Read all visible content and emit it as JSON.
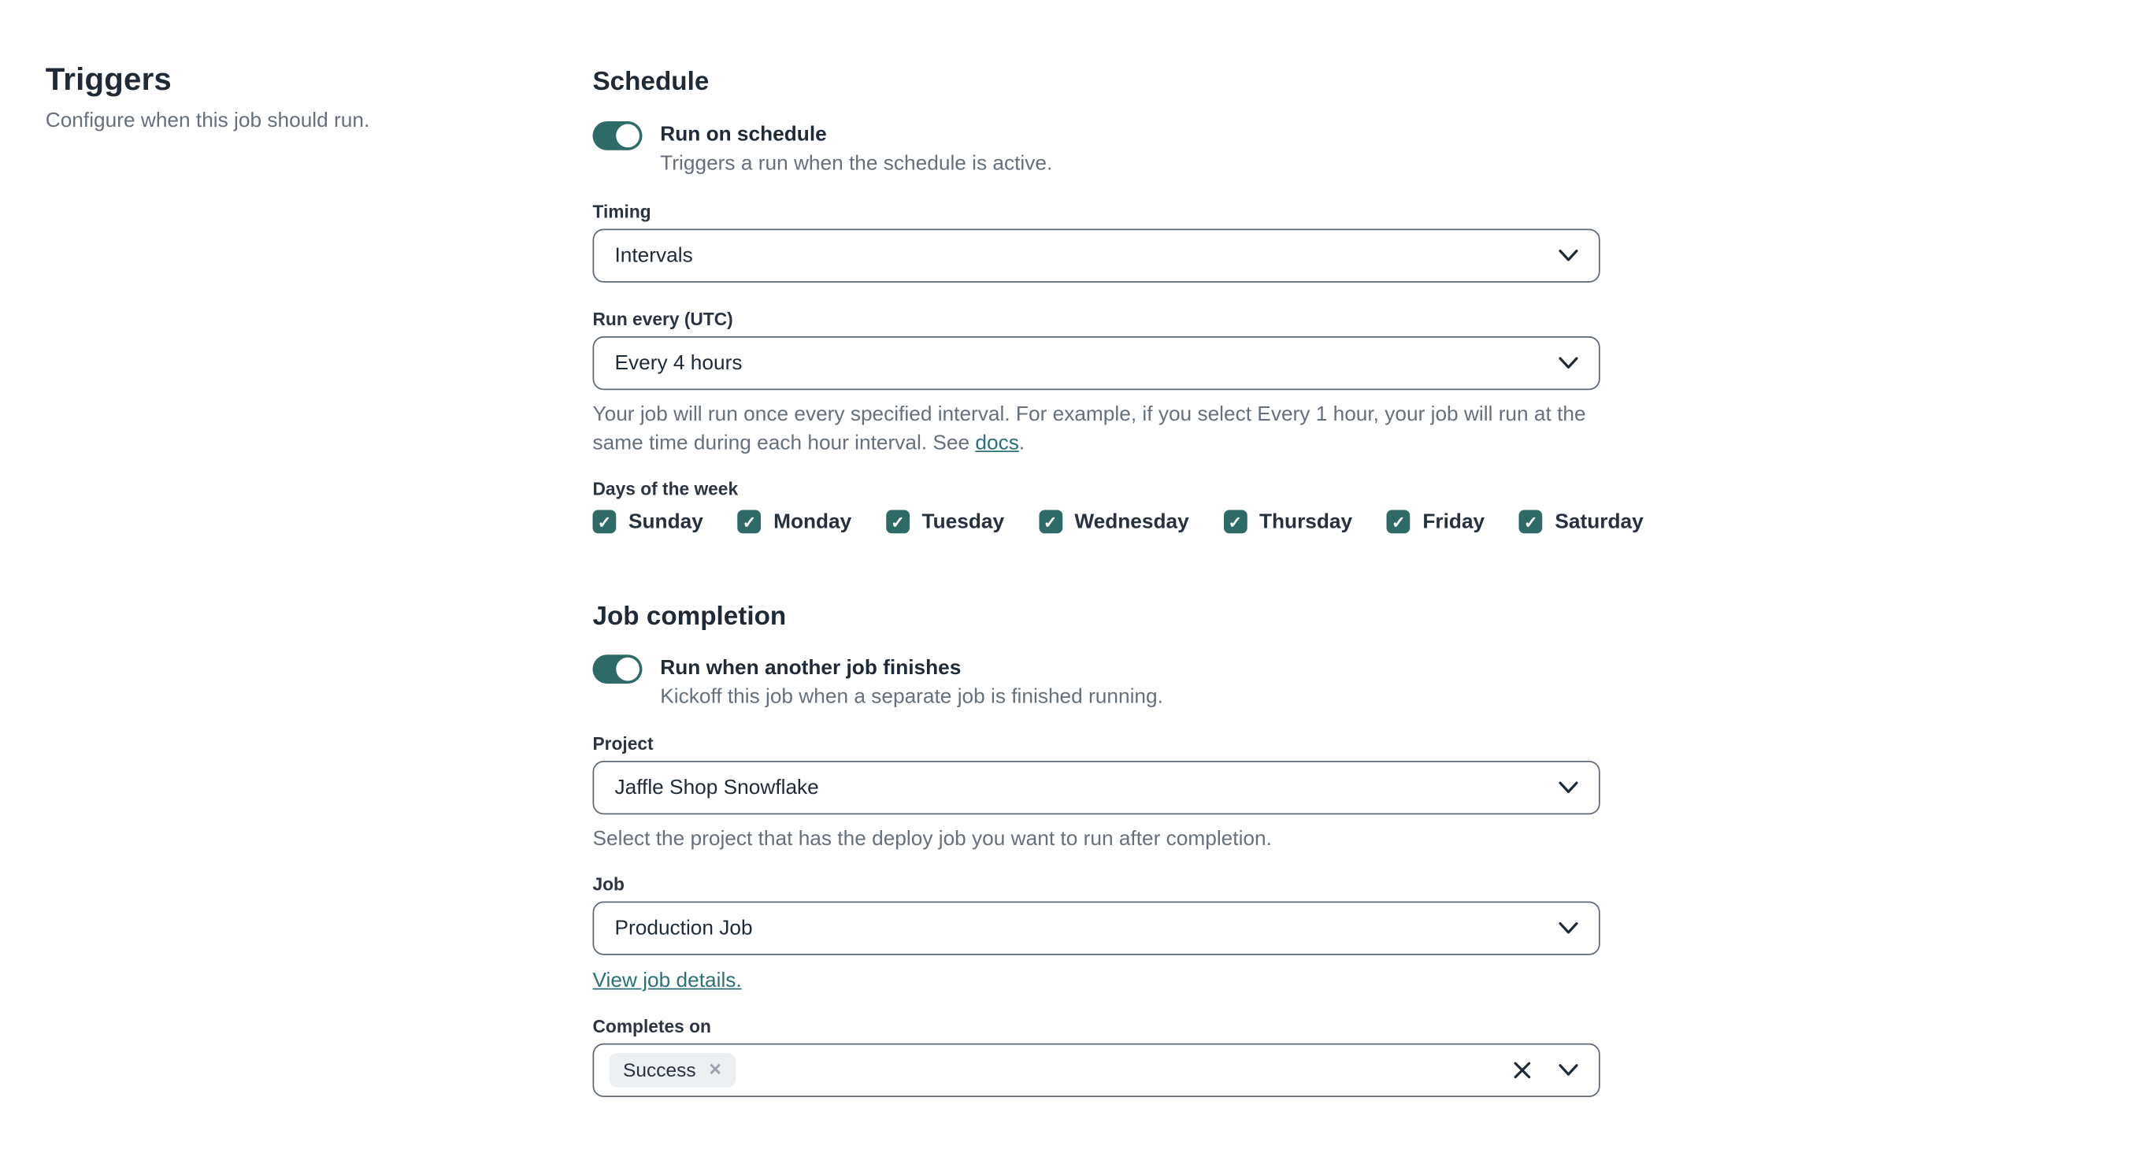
{
  "colors": {
    "accent_teal": "#2e6b66",
    "link_teal": "#2a717a",
    "heading_text": "#1f2a37",
    "muted_text": "#66707c",
    "input_border": "#5f6a76",
    "chip_background": "#edf0f3"
  },
  "sidebar": {
    "title": "Triggers",
    "subtitle": "Configure when this job should run."
  },
  "schedule": {
    "title": "Schedule",
    "run_on_schedule": {
      "label": "Run on schedule",
      "description": "Triggers a run when the schedule is active.",
      "enabled": true
    },
    "timing": {
      "label": "Timing",
      "value": "Intervals"
    },
    "run_every": {
      "label": "Run every (UTC)",
      "value": "Every 4 hours",
      "help_prefix": "Your job will run once every specified interval. For example, if you select Every 1 hour, your job will run at the same time during each hour interval. See ",
      "help_link_label": "docs",
      "help_suffix": "."
    },
    "days_of_week": {
      "label": "Days of the week",
      "items": [
        {
          "label": "Sunday",
          "checked": true
        },
        {
          "label": "Monday",
          "checked": true
        },
        {
          "label": "Tuesday",
          "checked": true
        },
        {
          "label": "Wednesday",
          "checked": true
        },
        {
          "label": "Thursday",
          "checked": true
        },
        {
          "label": "Friday",
          "checked": true
        },
        {
          "label": "Saturday",
          "checked": true
        }
      ]
    }
  },
  "job_completion": {
    "title": "Job completion",
    "run_when_another_job_finishes": {
      "label": "Run when another job finishes",
      "description": "Kickoff this job when a separate job is finished running.",
      "enabled": true
    },
    "project": {
      "label": "Project",
      "value": "Jaffle Shop Snowflake",
      "help": "Select the project that has the deploy job you want to run after completion."
    },
    "job": {
      "label": "Job",
      "value": "Production Job",
      "link_label": "View job details."
    },
    "completes_on": {
      "label": "Completes on",
      "selected_tags": [
        {
          "label": "Success"
        }
      ]
    }
  }
}
